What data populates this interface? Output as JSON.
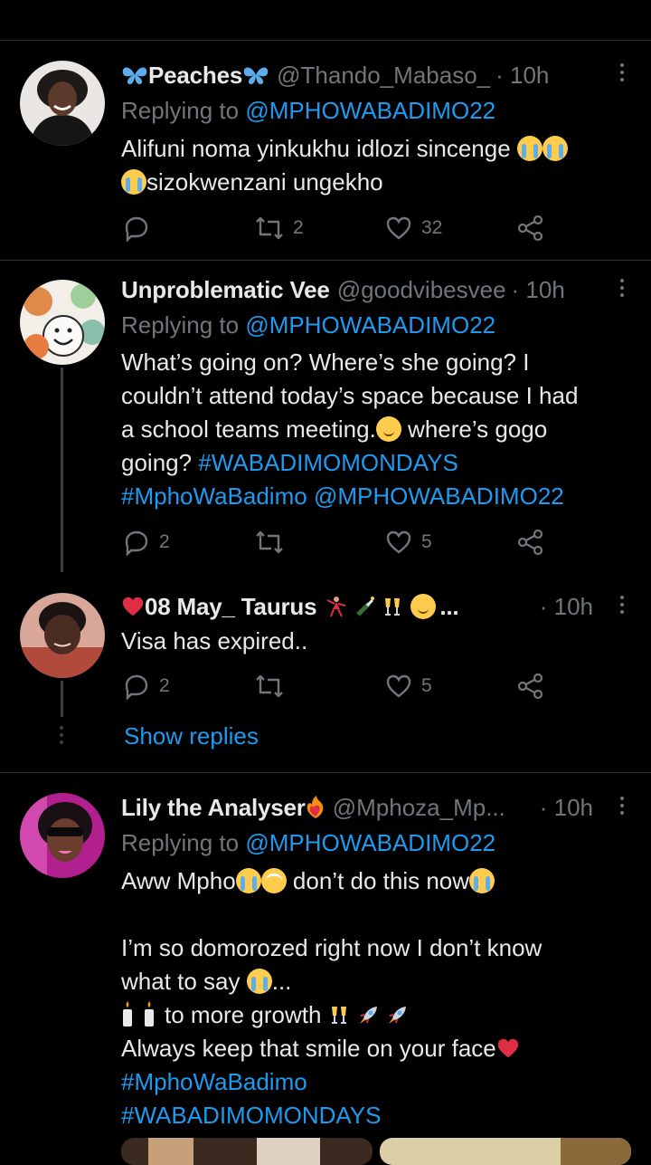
{
  "tweets": [
    {
      "name": "Peaches",
      "handle": "@Thando_Mabaso_",
      "time": "· 10h",
      "replying_prefix": "Replying to ",
      "replying_to": "@MPHOWABADIMO22",
      "text_lines": [
        "Alifuni noma yinkukhu idlozi sincenge",
        "sizokwenzani ungekho"
      ],
      "replies": "",
      "retweets": "2",
      "likes": "32"
    },
    {
      "name": "Unproblematic Vee",
      "handle": "@goodvibesvee",
      "time": "· 10h",
      "replying_prefix": "Replying to ",
      "replying_to": "@MPHOWABADIMO22",
      "text_lines": [
        "What’s going on? Where’s she going? I",
        "couldn’t attend today’s space because I had",
        "a school teams meeting.",
        " where’s gogo",
        "going? ",
        "#WABADIMOMONDAYS",
        "#MphoWaBadimo",
        "@MPHOWABADIMO22"
      ],
      "replies": "2",
      "retweets": "",
      "likes": "5"
    },
    {
      "name": "08 May_ Taurus",
      "name_suffix": "...",
      "handle": "",
      "time": "· 10h",
      "text_lines": [
        "Visa has expired.."
      ],
      "replies": "2",
      "retweets": "",
      "likes": "5"
    },
    {
      "name": "Lily the Analyser",
      "handle": "@Mphoza_Mp...",
      "time": "· 10h",
      "replying_prefix": "Replying to ",
      "replying_to": "@MPHOWABADIMO22",
      "text_lines": [
        "Aww Mpho",
        " don’t do this now",
        "I’m so domorozed right now I don’t know",
        "what to say ",
        "...",
        "to more growth ",
        "Always keep that smile on your face",
        "#MphoWaBadimo",
        "#WABADIMOMONDAYS"
      ]
    }
  ],
  "show_replies": "Show replies",
  "icons": {
    "reply": "reply-icon",
    "retweet": "retweet-icon",
    "like": "heart-icon",
    "share": "share-icon",
    "more": "more-icon"
  },
  "colors": {
    "background": "#000000",
    "link": "#1d9bf0",
    "muted": "#71767b",
    "text": "#e7e9ea",
    "separator": "#2f3336"
  }
}
